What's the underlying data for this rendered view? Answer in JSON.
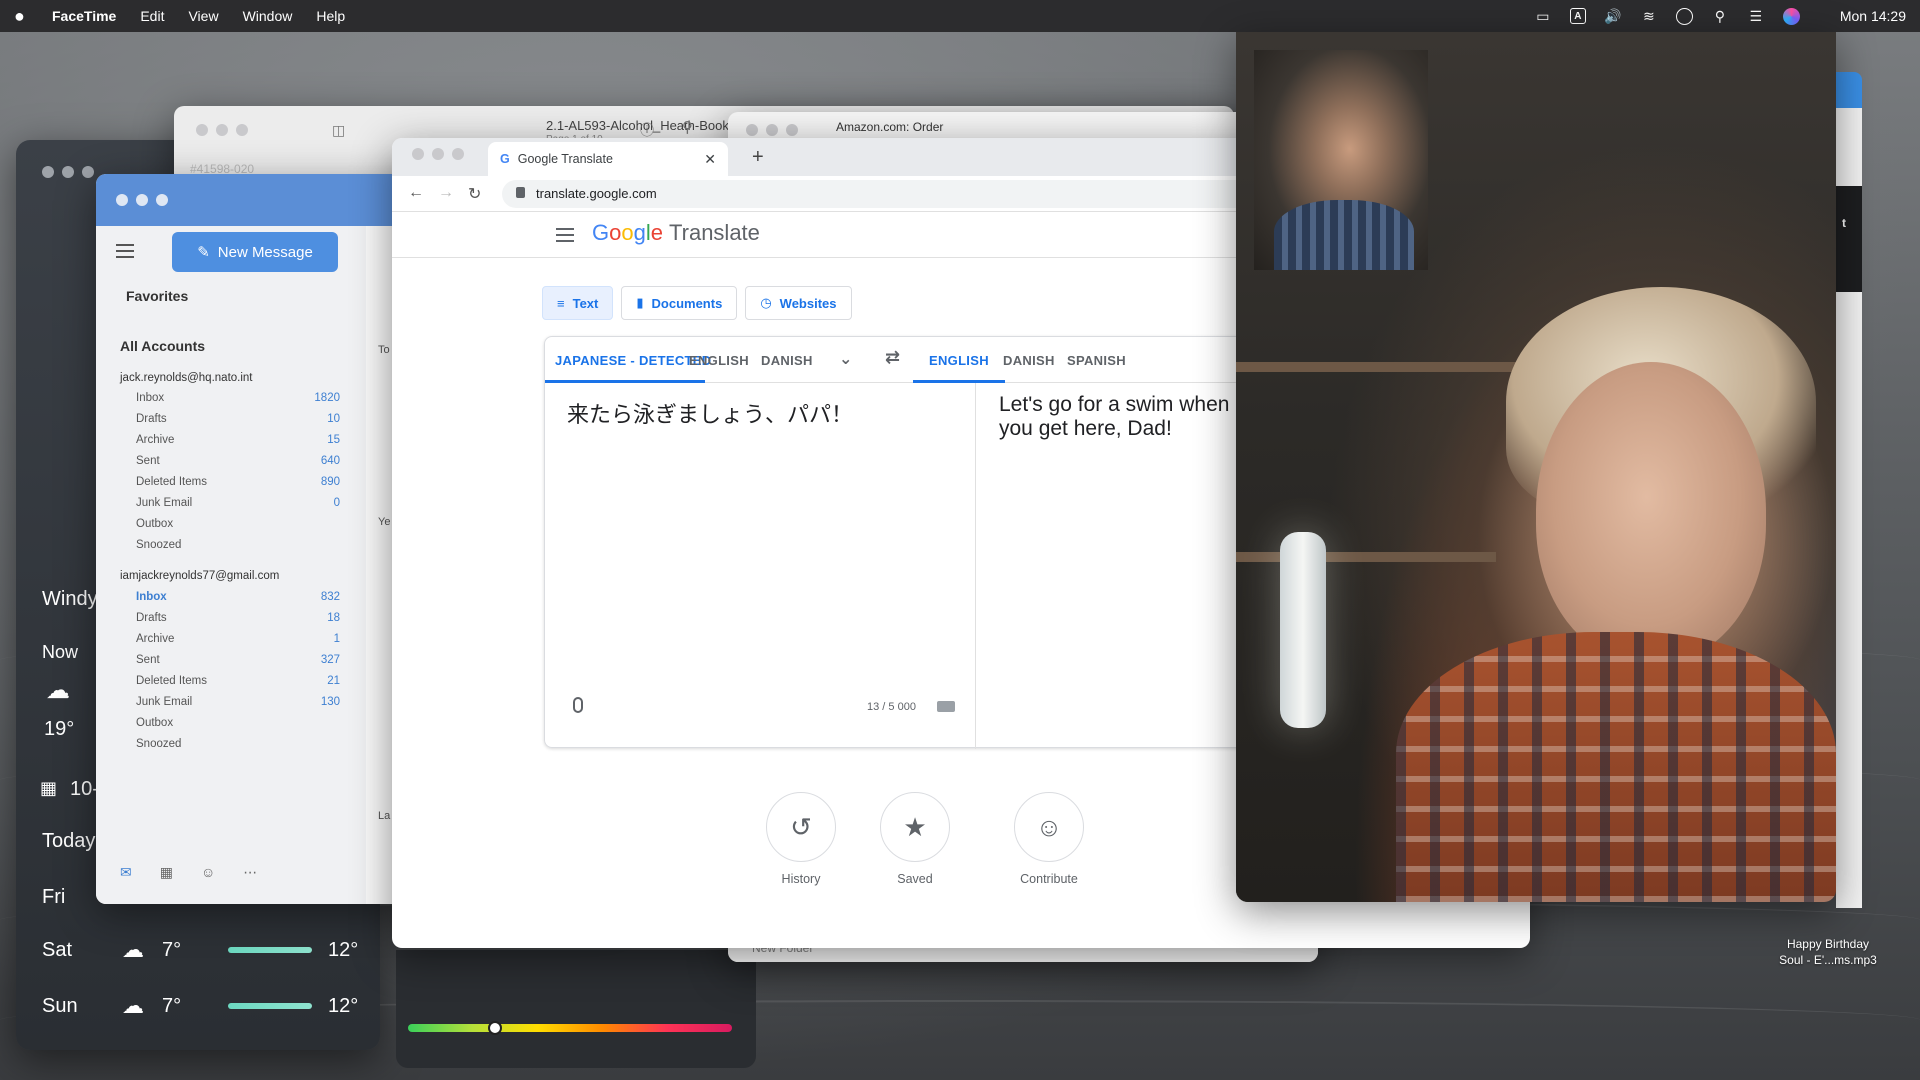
{
  "menubar": {
    "app_name": "FaceTime",
    "menus": [
      "Edit",
      "View",
      "Window",
      "Help"
    ],
    "keyboard_indicator": "A",
    "clock": "Mon 14:29"
  },
  "weather": {
    "condition": "Windy",
    "now_label": "Now",
    "now_temp": "19°",
    "calendar_label": "10-",
    "today_label": "Today",
    "fri_label": "Fri",
    "forecast": [
      {
        "day": "Sat",
        "low": "7°",
        "high": "12°",
        "icon": "rain-cloud-icon"
      },
      {
        "day": "Sun",
        "low": "7°",
        "high": "12°",
        "icon": "rain-cloud-icon"
      }
    ]
  },
  "pdf_window": {
    "title": "2.1-AL593-Alcohol_Heath-Booklets_St...",
    "subtitle": "Page 1 of 10",
    "ref": "#41598-020"
  },
  "amazon_window": {
    "tab_title": "Amazon.com: Order",
    "footer": "New Folder"
  },
  "mail": {
    "new_message_label": "New Message",
    "favorites_label": "Favorites",
    "all_accounts_label": "All Accounts",
    "accounts": [
      {
        "email": "jack.reynolds@hq.nato.int",
        "folders": [
          {
            "name": "Inbox",
            "count": "1820"
          },
          {
            "name": "Drafts",
            "count": "10"
          },
          {
            "name": "Archive",
            "count": "15"
          },
          {
            "name": "Sent",
            "count": "640"
          },
          {
            "name": "Deleted Items",
            "count": "890"
          },
          {
            "name": "Junk Email",
            "count": "0"
          },
          {
            "name": "Outbox",
            "count": ""
          },
          {
            "name": "Snoozed",
            "count": ""
          }
        ]
      },
      {
        "email": "iamjackreynolds77@gmail.com",
        "folders": [
          {
            "name": "Inbox",
            "count": "832"
          },
          {
            "name": "Drafts",
            "count": "18"
          },
          {
            "name": "Archive",
            "count": "1"
          },
          {
            "name": "Sent",
            "count": "327"
          },
          {
            "name": "Deleted Items",
            "count": "21"
          },
          {
            "name": "Junk Email",
            "count": "130"
          },
          {
            "name": "Outbox",
            "count": ""
          },
          {
            "name": "Snoozed",
            "count": ""
          }
        ]
      }
    ],
    "list_labels": [
      "To",
      "Ye",
      "La"
    ]
  },
  "translate": {
    "tab_title": "Google Translate",
    "url": "translate.google.com",
    "logo_word": "Google",
    "product": "Translate",
    "modes": [
      "Text",
      "Documents",
      "Websites"
    ],
    "source_langs": [
      "JAPANESE - DETECTED",
      "ENGLISH",
      "DANISH"
    ],
    "target_langs": [
      "ENGLISH",
      "DANISH",
      "SPANISH"
    ],
    "source_text": "来たら泳ぎましょう、パパ！",
    "translated_text": "Let's go for a swim when you get here, Dad!",
    "char_count": "13 / 5 000",
    "actions": [
      "History",
      "Saved",
      "Contribute"
    ]
  },
  "desktop_file": {
    "line1": "Happy Birthday",
    "line2": "Soul - E'...ms.mp3"
  },
  "colors": {
    "accent_blue": "#1a73e8",
    "mail_blue": "#4e8fe0",
    "menubar": "#2c2c2e"
  }
}
